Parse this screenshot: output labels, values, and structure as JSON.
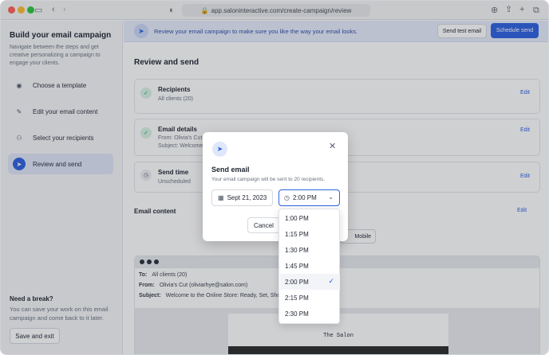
{
  "browser": {
    "url": "app.saloninteractive.com/create-campaign/review"
  },
  "sidebar": {
    "title": "Build your email campaign",
    "description": "Navigate between the steps and get creative personalizing a campaign to engage your clients.",
    "steps": [
      {
        "label": "Choose a template",
        "icon": "template-icon"
      },
      {
        "label": "Edit your email content",
        "icon": "pencil-icon"
      },
      {
        "label": "Select your recipients",
        "icon": "users-icon"
      },
      {
        "label": "Review and send",
        "icon": "send-icon",
        "active": true
      }
    ],
    "break_title": "Need a break?",
    "break_text": "You can save your work on this email campaign and come back to it later.",
    "save_button": "Save and exit"
  },
  "banner": {
    "text": "Review your email campaign to make sure you like the way your email looks.",
    "test_button": "Send test email",
    "schedule_button": "Schedule send"
  },
  "review": {
    "heading": "Review and send",
    "recipients": {
      "title": "Recipients",
      "sub": "All clients (20)",
      "edit": "Edit"
    },
    "details": {
      "title": "Email details",
      "from": "From: Olivia's Cut (o",
      "subject": "Subject: Welcome t",
      "edit": "Edit"
    },
    "send_time": {
      "title": "Send time",
      "sub": "Unscheduled",
      "edit": "Edit"
    },
    "email_content": {
      "title": "Email content",
      "edit": "Edit",
      "mobile": "Mobile"
    }
  },
  "preview": {
    "to_label": "To:",
    "to": "All clients (20)",
    "from_label": "From:",
    "from": "Olivia's Cut (oliviarhye@salon.com)",
    "subject_label": "Subject:",
    "subject": "Welcome to the Online Store: Ready, Set, Shop!",
    "salon_name": "The Salon"
  },
  "modal": {
    "title": "Send email",
    "description": "Your email campaign will be sent to 20 recipients.",
    "date": "Sept 21, 2023",
    "time": "2:00 PM",
    "cancel": "Cancel"
  },
  "time_options": [
    "1:00 PM",
    "1:15 PM",
    "1:30 PM",
    "1:45 PM",
    "2:00 PM",
    "2:15 PM",
    "2:30 PM"
  ],
  "selected_time": "2:00 PM",
  "colors": {
    "accent": "#2e61e0",
    "success": "#1f9d57"
  }
}
